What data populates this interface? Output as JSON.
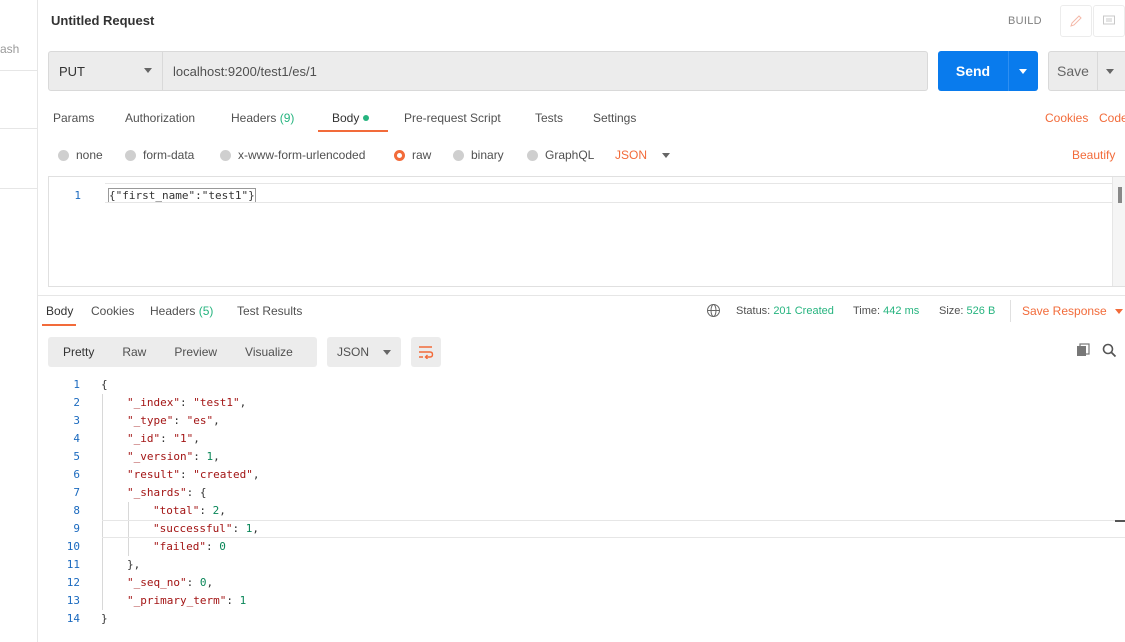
{
  "sidebar": {
    "fragment": "ash"
  },
  "header": {
    "title": "Untitled Request",
    "build_label": "BUILD"
  },
  "request": {
    "method": "PUT",
    "url": "localhost:9200/test1/es/1",
    "send_label": "Send",
    "save_label": "Save"
  },
  "tabs": [
    {
      "label": "Params"
    },
    {
      "label": "Authorization"
    },
    {
      "label": "Headers",
      "count": "(9)"
    },
    {
      "label": "Body"
    },
    {
      "label": "Pre-request Script"
    },
    {
      "label": "Tests"
    },
    {
      "label": "Settings"
    }
  ],
  "links": {
    "cookies": "Cookies",
    "code": "Code",
    "beautify": "Beautify"
  },
  "body_types": [
    {
      "label": "none"
    },
    {
      "label": "form-data"
    },
    {
      "label": "x-www-form-urlencoded"
    },
    {
      "label": "raw"
    },
    {
      "label": "binary"
    },
    {
      "label": "GraphQL"
    }
  ],
  "body_format": "JSON",
  "request_body": {
    "line_number": "1",
    "text": "{\"first_name\":\"test1\"}"
  },
  "response": {
    "tabs": [
      {
        "label": "Body"
      },
      {
        "label": "Cookies"
      },
      {
        "label": "Headers",
        "count": "(5)"
      },
      {
        "label": "Test Results"
      }
    ],
    "status_label": "Status:",
    "status_value": "201 Created",
    "time_label": "Time:",
    "time_value": "442 ms",
    "size_label": "Size:",
    "size_value": "526 B",
    "save_response": "Save Response",
    "views": [
      "Pretty",
      "Raw",
      "Preview",
      "Visualize"
    ],
    "format": "JSON",
    "lines": [
      {
        "n": "1",
        "indent": 0,
        "text": "{"
      },
      {
        "n": "2",
        "indent": 1,
        "key": "\"_index\"",
        "val": "\"test1\"",
        "vtype": "s",
        "tail": ","
      },
      {
        "n": "3",
        "indent": 1,
        "key": "\"_type\"",
        "val": "\"es\"",
        "vtype": "s",
        "tail": ","
      },
      {
        "n": "4",
        "indent": 1,
        "key": "\"_id\"",
        "val": "\"1\"",
        "vtype": "s",
        "tail": ","
      },
      {
        "n": "5",
        "indent": 1,
        "key": "\"_version\"",
        "val": "1",
        "vtype": "n",
        "tail": ","
      },
      {
        "n": "6",
        "indent": 1,
        "key": "\"result\"",
        "val": "\"created\"",
        "vtype": "s",
        "tail": ","
      },
      {
        "n": "7",
        "indent": 1,
        "key": "\"_shards\"",
        "val": "{",
        "vtype": "p",
        "tail": ""
      },
      {
        "n": "8",
        "indent": 2,
        "key": "\"total\"",
        "val": "2",
        "vtype": "n",
        "tail": ","
      },
      {
        "n": "9",
        "indent": 2,
        "key": "\"successful\"",
        "val": "1",
        "vtype": "n",
        "tail": ","
      },
      {
        "n": "10",
        "indent": 2,
        "key": "\"failed\"",
        "val": "0",
        "vtype": "n",
        "tail": ""
      },
      {
        "n": "11",
        "indent": 1,
        "text": "},"
      },
      {
        "n": "12",
        "indent": 1,
        "key": "\"_seq_no\"",
        "val": "0",
        "vtype": "n",
        "tail": ","
      },
      {
        "n": "13",
        "indent": 1,
        "key": "\"_primary_term\"",
        "val": "1",
        "vtype": "n",
        "tail": ""
      },
      {
        "n": "14",
        "indent": 0,
        "text": "}"
      }
    ]
  },
  "icons": {
    "edit": "pencil-icon",
    "comments": "comment-icon",
    "globe": "globe-icon",
    "copy": "copy-icon",
    "search": "search-icon",
    "wrap": "wrap-lines-icon"
  },
  "colors": {
    "accent": "#f26b3a",
    "send": "#097bed",
    "success": "#26b47f"
  }
}
